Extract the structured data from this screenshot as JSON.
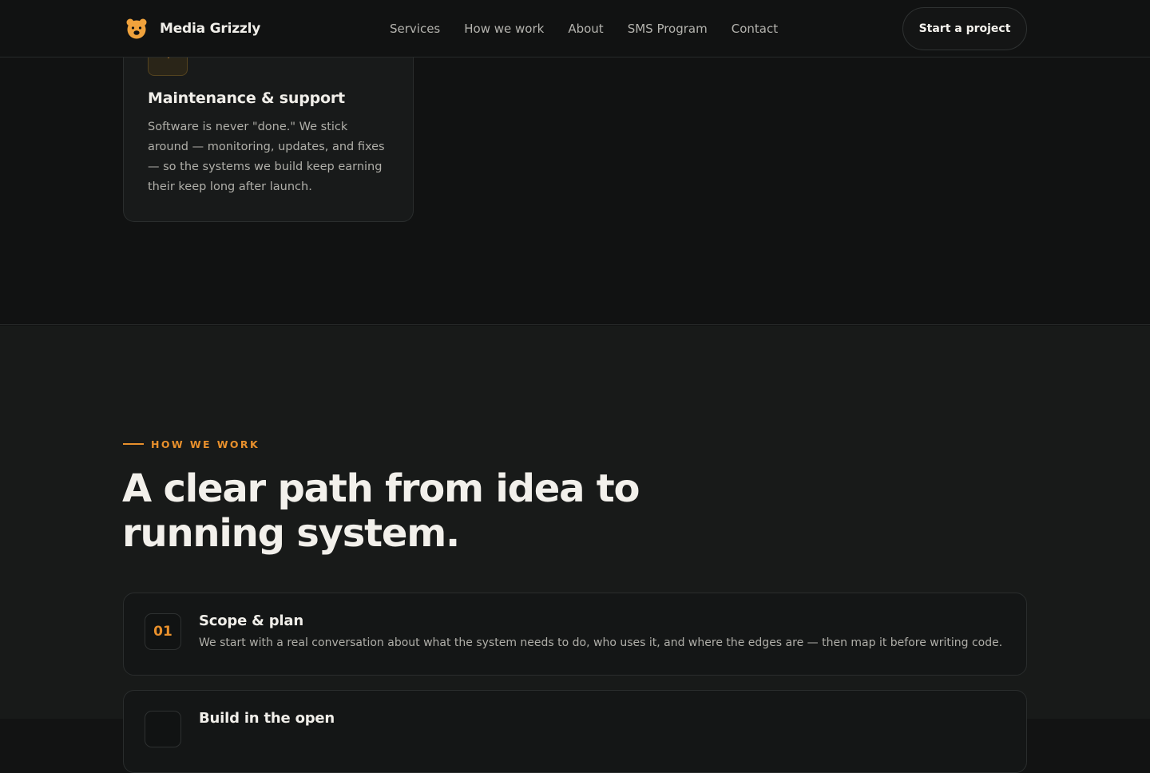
{
  "header": {
    "brand_name": "Media Grizzly",
    "logo_icon": "bear-logo-icon",
    "nav": [
      "Services",
      "How we work",
      "About",
      "SMS Program",
      "Contact"
    ],
    "cta_label": "Start a project"
  },
  "services": {
    "card": {
      "icon": "heart-icon",
      "title": "Maintenance & support",
      "body": "Software is never \"done.\" We stick around — monitoring, updates, and fixes — so the systems we build keep earning their keep long after launch."
    }
  },
  "how_we_work": {
    "eyebrow": "HOW WE WORK",
    "heading": "A clear path from idea to running system.",
    "steps": [
      {
        "number": "01",
        "title": "Scope & plan",
        "description": "We start with a real conversation about what the system needs to do, who uses it, and where the edges are — then map it before writing code."
      },
      {
        "number": "",
        "title": "Build in the open",
        "description": ""
      }
    ]
  },
  "colors": {
    "accent": "#e8902c",
    "page_background": "#111212",
    "section_background": "#181a19",
    "text_primary": "#f0eee9",
    "text_secondary": "#b0afa9"
  }
}
